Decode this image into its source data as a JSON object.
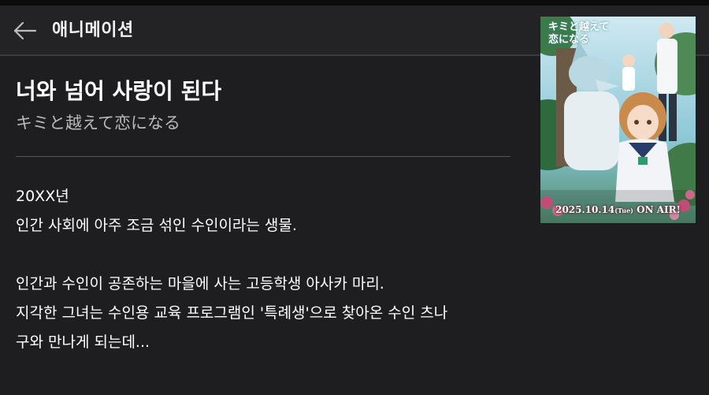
{
  "header": {
    "back_icon": "arrow-left-icon",
    "title": "애니메이션"
  },
  "anime": {
    "title": "너와 넘어 사랑이 된다",
    "original_title": "キミと越えて恋になる",
    "description": [
      "20XX년",
      "인간 사회에 아주 조금 섞인 수인이라는 생물.",
      "",
      "인간과 수인이 공존하는 마을에 사는 고등학생 아사카 마리.",
      "지각한 그녀는 수인용 교육 프로그램인 '특례생'으로 찾아온 수인 츠나",
      "구와 만나게 되는데..."
    ]
  },
  "poster": {
    "logo_text": "キミと越えて恋になる",
    "air_date": "2025.10.14",
    "air_day": "(Tue)",
    "air_label": "ON AIR!"
  },
  "colors": {
    "background": "#1e1e20",
    "header": "#232325",
    "text": "#ffffff",
    "subtext": "#b9b9bb"
  }
}
